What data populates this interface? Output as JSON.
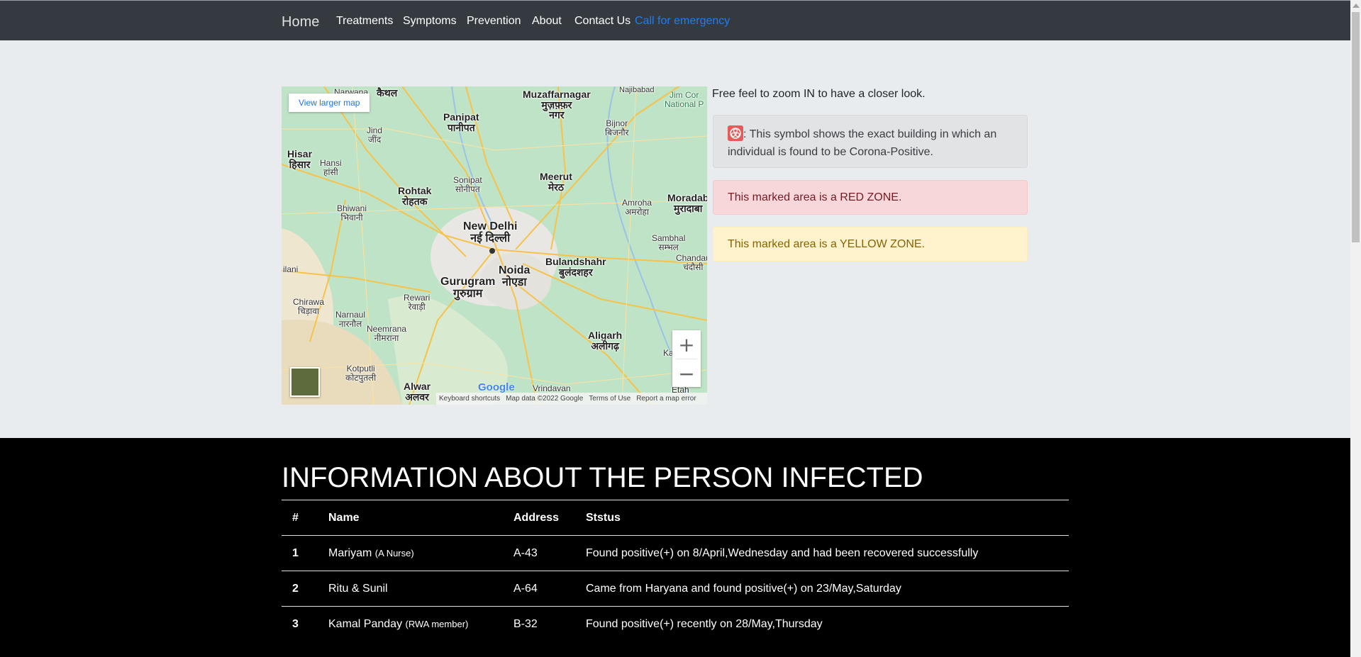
{
  "nav": {
    "brand": "Home",
    "links": [
      "Treatments",
      "Symptoms",
      "Prevention",
      "About",
      "Contact Us"
    ],
    "emergency": "Call for emergency",
    "emergency_color": "#1f7cf2"
  },
  "map": {
    "view_larger": "View larger map",
    "zoom_in": "+",
    "zoom_out": "−",
    "google": "Google",
    "attribution": {
      "keyboard": "Keyboard shortcuts",
      "data": "Map data ©2022 Google",
      "terms": "Terms of Use",
      "report": "Report a map error"
    },
    "labels": {
      "narwana": "Narwana",
      "kaithal": "कैथल",
      "muzaffarnagar": "Muzaffarnagar\nमुज़फ़्फ़र\nनगर",
      "najibabad": "Najibabad",
      "jimcorbett": "Jim Cor\nNational P",
      "panipat": "Panipat\nपानीपत",
      "jind": "Jind\nजींद",
      "bijnor": "Bijnor\nबिजनौर",
      "hisar": "Hisar\nहिसार",
      "hansi": "Hansi\nहांसी",
      "sonipat": "Sonipat\nसोनीपत",
      "meerut": "Meerut\nमेरठ",
      "rohtak": "Rohtak\nरोहतक",
      "amroha": "Amroha\nअमरोहा",
      "moradabad": "Moradab\nमुरादाबा",
      "bhiwani": "Bhiwani\nभिवानी",
      "newdelhi": "New Delhi\nनई दिल्ली",
      "sambhal": "Sambhal\nसम्भल",
      "bulandshahr": "Bulandshahr\nबुलंदशहर",
      "chandausi": "Chandau\nचंदौसी",
      "noida": "Noida\nनोएडा",
      "gurugram": "Gurugram\nगुरुग्राम",
      "ilani": "ilani",
      "rewari": "Rewari\nरेवाड़ी",
      "chirawa": "Chirawa\nचिड़ावा",
      "narnaul": "Narnaul\nनारनौल",
      "neemrana": "Neemrana\nनीमराना",
      "aligarh": "Aligarh\nअलीगढ़",
      "kotputli": "Kotputli\nकोटपुतली",
      "alwar": "Alwar\nअलवर",
      "vrindavan": "Vrindavan",
      "etah": "Etah",
      "ka": "Ka"
    }
  },
  "info": {
    "zoom_note": "Free feel to zoom IN to have a closer look.",
    "symbol_text": ": This symbol shows the exact building in which an individual is found to be Corona-Positive.",
    "red_zone": "This marked area is a RED ZONE.",
    "yellow_zone": "This marked area is a YELLOW ZONE.",
    "red_color": "#f8d7da",
    "yellow_color": "#fff3cd"
  },
  "table": {
    "title": "INFORMATION ABOUT THE PERSON INFECTED",
    "headers": [
      "#",
      "Name",
      "Address",
      "Ststus"
    ],
    "rows": [
      {
        "num": "1",
        "name": "Mariyam",
        "note": "(A Nurse)",
        "address": "A-43",
        "status": "Found positive(+) on 8/April,Wednesday and had been recovered successfully"
      },
      {
        "num": "2",
        "name": "Ritu & Sunil",
        "note": "",
        "address": "A-64",
        "status": "Came from Haryana and found positive(+) on 23/May,Saturday"
      },
      {
        "num": "3",
        "name": "Kamal Panday",
        "note": "(RWA member)",
        "address": "B-32",
        "status": "Found positive(+) recently on 28/May,Thursday"
      }
    ]
  }
}
